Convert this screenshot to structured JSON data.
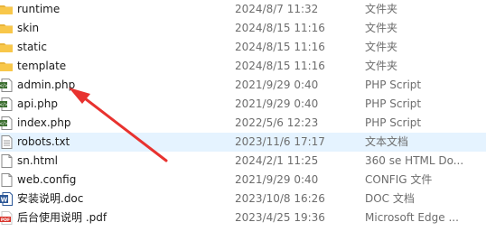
{
  "files": [
    {
      "icon": "folder-icon",
      "name": "runtime",
      "date": "2024/8/7 11:32",
      "type": "文件夹"
    },
    {
      "icon": "folder-icon",
      "name": "skin",
      "date": "2024/8/15 11:16",
      "type": "文件夹"
    },
    {
      "icon": "folder-icon",
      "name": "static",
      "date": "2024/8/15 11:16",
      "type": "文件夹"
    },
    {
      "icon": "folder-icon",
      "name": "template",
      "date": "2024/8/15 11:16",
      "type": "文件夹"
    },
    {
      "icon": "php-file-icon",
      "name": "admin.php",
      "date": "2021/9/29 0:40",
      "type": "PHP Script"
    },
    {
      "icon": "php-file-icon",
      "name": "api.php",
      "date": "2021/9/29 0:40",
      "type": "PHP Script"
    },
    {
      "icon": "php-file-icon",
      "name": "index.php",
      "date": "2022/5/6 12:23",
      "type": "PHP Script"
    },
    {
      "icon": "text-file-icon",
      "name": "robots.txt",
      "date": "2023/11/6 17:17",
      "type": "文本文档"
    },
    {
      "icon": "html-file-icon",
      "name": "sn.html",
      "date": "2024/2/1 11:25",
      "type": "360 se HTML Do..."
    },
    {
      "icon": "config-file-icon",
      "name": "web.config",
      "date": "2021/9/29 0:40",
      "type": "CONFIG 文件"
    },
    {
      "icon": "word-doc-icon",
      "name": "安装说明.doc",
      "date": "2023/10/8 16:26",
      "type": "DOC 文档"
    },
    {
      "icon": "pdf-file-icon",
      "name": "后台使用说明 .pdf",
      "date": "2023/4/25 19:36",
      "type": "Microsoft Edge ..."
    }
  ],
  "highlighted_row": "robots.txt",
  "annotation_arrow": {
    "color": "#e8322f",
    "icon": "red-arrow-annotation"
  },
  "colors": {
    "folder": "#f8c74a",
    "highlight": "#e5f3ff",
    "secondary_text": "#6d6d6d"
  }
}
